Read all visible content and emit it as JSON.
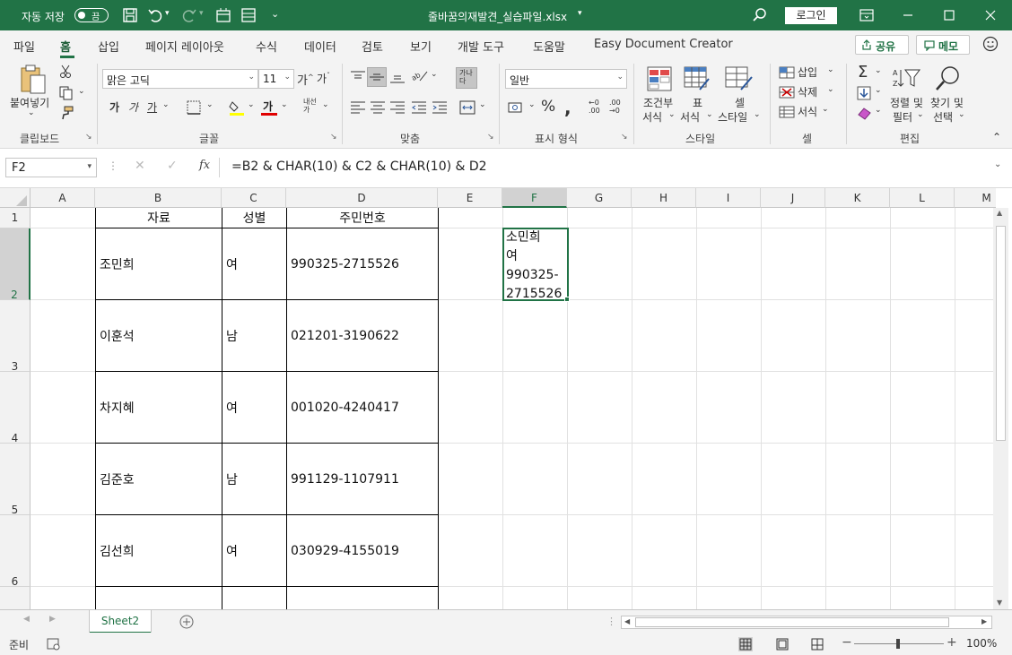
{
  "titlebar": {
    "autosave_label": "자동 저장",
    "autosave_state": "끔",
    "filename": "줄바꿈의재발견_실습파일.xlsx",
    "login": "로그인"
  },
  "tabs": [
    "파일",
    "홈",
    "삽입",
    "페이지 레이아웃",
    "수식",
    "데이터",
    "검토",
    "보기",
    "개발 도구",
    "도움말",
    "Easy Document Creator"
  ],
  "share_label": "공유",
  "memo_label": "메모",
  "ribbon": {
    "clipboard": {
      "paste": "붙여넣기",
      "label": "클립보드"
    },
    "font": {
      "name": "맑은 고딕",
      "size": "11",
      "label": "글꼴"
    },
    "align": {
      "label": "맞춤"
    },
    "number": {
      "format": "일반",
      "label": "표시 형식"
    },
    "styles": {
      "cond": "조건부\n서식",
      "cond1": "조건부",
      "cond2": "서식",
      "table1": "표",
      "table2": "서식",
      "cell1": "셀",
      "cell2": "스타일",
      "label": "스타일"
    },
    "cells": {
      "insert": "삽입",
      "delete": "삭제",
      "format": "서식",
      "label": "셀"
    },
    "edit": {
      "sort1": "정렬 및",
      "sort2": "필터",
      "find1": "찾기 및",
      "find2": "선택",
      "label": "편집"
    }
  },
  "formula_bar": {
    "name_box": "F2",
    "formula": "=B2 & CHAR(10) & C2 & CHAR(10) & D2"
  },
  "columns": [
    "A",
    "B",
    "C",
    "D",
    "E",
    "F",
    "G",
    "H",
    "I",
    "J",
    "K",
    "L",
    "M"
  ],
  "rows": [
    "1",
    "2",
    "3",
    "4",
    "5",
    "6"
  ],
  "table": {
    "headers": [
      "자료",
      "성별",
      "주민번호"
    ],
    "rows": [
      {
        "name": "조민희",
        "gender": "여",
        "id": "990325-2715526"
      },
      {
        "name": "이훈석",
        "gender": "남",
        "id": "021201-3190622"
      },
      {
        "name": "차지혜",
        "gender": "여",
        "id": "001020-4240417"
      },
      {
        "name": "김준호",
        "gender": "남",
        "id": "991129-1107911"
      },
      {
        "name": "김선희",
        "gender": "여",
        "id": "030929-4155019"
      }
    ]
  },
  "result_cell": {
    "line1": "소민희",
    "line2": "여",
    "line3": "990325-",
    "line4": "2715526"
  },
  "sheet_tab": "Sheet2",
  "status": {
    "ready": "준비",
    "zoom": "100%"
  }
}
